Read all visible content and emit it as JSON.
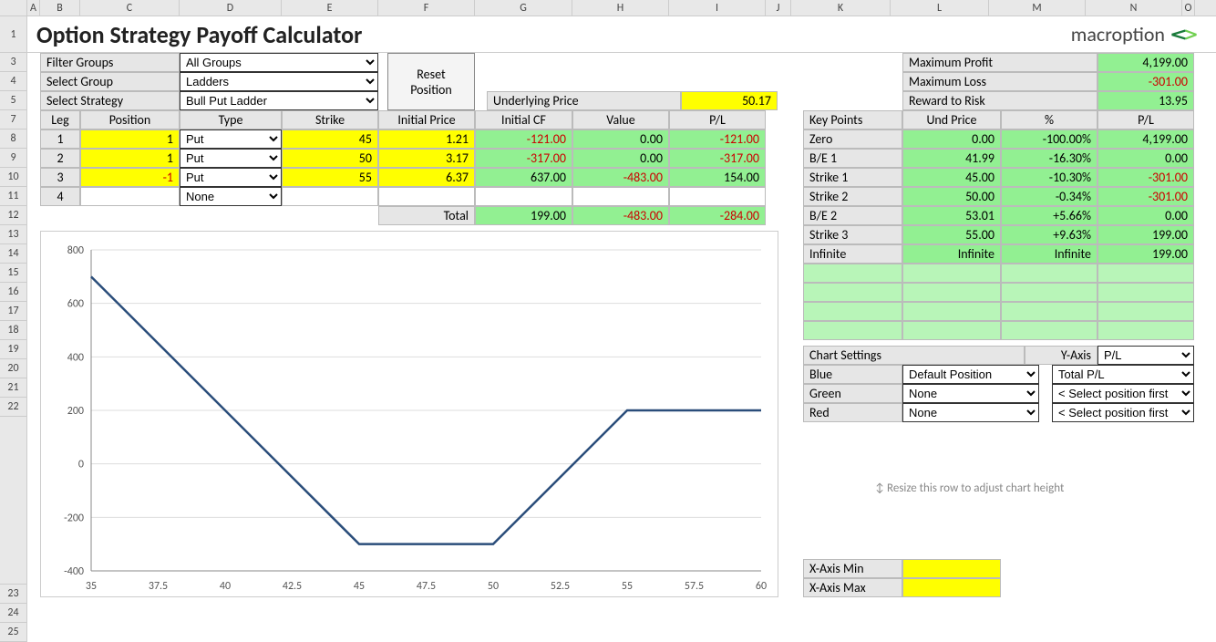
{
  "title": "Option Strategy Payoff Calculator",
  "brand": "macroption",
  "filters": {
    "row1_label": "Filter Groups",
    "row1_value": "All Groups",
    "row2_label": "Select Group",
    "row2_value": "Ladders",
    "row3_label": "Select Strategy",
    "row3_value": "Bull Put Ladder"
  },
  "reset_btn_l1": "Reset",
  "reset_btn_l2": "Position",
  "underlying_label": "Underlying Price",
  "underlying_value": "50.17",
  "legs_header": [
    "Leg",
    "Position",
    "Type",
    "Strike",
    "Initial Price",
    "Initial CF",
    "Value",
    "P/L"
  ],
  "legs": [
    {
      "n": "1",
      "pos": "1",
      "type": "Put",
      "strike": "45",
      "iprice": "1.21",
      "icf": "-121.00",
      "val": "0.00",
      "pl": "-121.00"
    },
    {
      "n": "2",
      "pos": "1",
      "type": "Put",
      "strike": "50",
      "iprice": "3.17",
      "icf": "-317.00",
      "val": "0.00",
      "pl": "-317.00"
    },
    {
      "n": "3",
      "pos": "-1",
      "type": "Put",
      "strike": "55",
      "iprice": "6.37",
      "icf": "637.00",
      "val": "-483.00",
      "pl": "154.00"
    },
    {
      "n": "4",
      "pos": "",
      "type": "None",
      "strike": "",
      "iprice": "",
      "icf": "",
      "val": "",
      "pl": ""
    }
  ],
  "total_label": "Total",
  "total": {
    "icf": "199.00",
    "val": "-483.00",
    "pl": "-284.00"
  },
  "summary": {
    "max_profit_l": "Maximum Profit",
    "max_profit_v": "4,199.00",
    "max_loss_l": "Maximum Loss",
    "max_loss_v": "-301.00",
    "reward_l": "Reward to Risk",
    "reward_v": "13.95"
  },
  "kp_header": [
    "Key Points",
    "Und Price",
    "%",
    "P/L"
  ],
  "kp": [
    {
      "a": "Zero",
      "b": "0.00",
      "c": "-100.00%",
      "d": "4,199.00"
    },
    {
      "a": "B/E 1",
      "b": "41.99",
      "c": "-16.30%",
      "d": "0.00"
    },
    {
      "a": "Strike 1",
      "b": "45.00",
      "c": "-10.30%",
      "d": "-301.00"
    },
    {
      "a": "Strike 2",
      "b": "50.00",
      "c": "-0.34%",
      "d": "-301.00"
    },
    {
      "a": "B/E 2",
      "b": "53.01",
      "c": "+5.66%",
      "d": "0.00"
    },
    {
      "a": "Strike 3",
      "b": "55.00",
      "c": "+9.63%",
      "d": "199.00"
    },
    {
      "a": "Infinite",
      "b": "Infinite",
      "c": "Infinite",
      "d": "199.00"
    }
  ],
  "chart_settings": {
    "title": "Chart Settings",
    "yaxis_l": "Y-Axis",
    "yaxis_v": "P/L",
    "blue_l": "Blue",
    "blue_v": "Default Position",
    "blue_r": "Total P/L",
    "green_l": "Green",
    "green_v": "None",
    "green_r": "< Select position first",
    "red_l": "Red",
    "red_v": "None",
    "red_r": "< Select position first",
    "hint": "↕ Resize this row to adjust chart height",
    "xmin_l": "X-Axis Min",
    "xmin_v": "",
    "xmax_l": "X-Axis Max",
    "xmax_v": ""
  },
  "chart_data": {
    "type": "line",
    "xlabel": "",
    "ylabel": "",
    "xlim": [
      35,
      60
    ],
    "ylim": [
      -400,
      800
    ],
    "x_ticks": [
      35,
      37.5,
      40,
      42.5,
      45,
      47.5,
      50,
      52.5,
      55,
      57.5,
      60
    ],
    "y_ticks": [
      -400,
      -200,
      0,
      200,
      400,
      600,
      800
    ],
    "series": [
      {
        "name": "Total P/L",
        "color": "#2a4d7a",
        "x": [
          35,
          45,
          50,
          55,
          60
        ],
        "y": [
          700,
          -300,
          -300,
          200,
          200
        ]
      }
    ]
  },
  "col_widths": {
    "rowhdr": 30,
    "A": 14,
    "B": 44,
    "C": 109,
    "D": 112,
    "E": 106,
    "F": 106,
    "G": 107,
    "H": 106,
    "I": 106,
    "J": 28,
    "K": 109,
    "L": 108,
    "M": 106,
    "N": 106,
    "O": 14
  },
  "row_heights": {
    "hdr": 18,
    "1": 40,
    "default": 21
  }
}
